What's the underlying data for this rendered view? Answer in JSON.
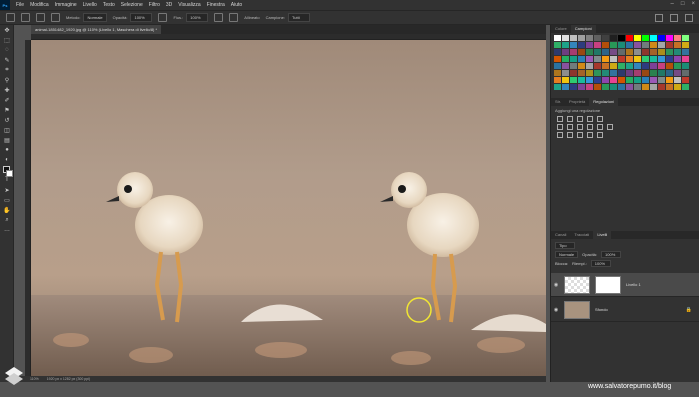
{
  "menubar": {
    "app_logo": "Ps",
    "items": [
      "File",
      "Modifica",
      "Immagine",
      "Livello",
      "Testo",
      "Selezione",
      "Filtro",
      "3D",
      "Visualizza",
      "Finestra",
      "Aiuto"
    ]
  },
  "options": {
    "metodo_label": "Metodo:",
    "metodo_value": "Normale",
    "opacita_label": "Opacità:",
    "opacita_value": "100%",
    "flusso_label": "Flus.:",
    "flusso_value": "100%",
    "allinea_label": "Allineato",
    "campione_label": "Campione:",
    "campione_value": "Tutti"
  },
  "document": {
    "tab_title": "animal-1851482_1920.jpg @ 110% (Livello 1, Maschera di livello/8) *",
    "zoom": "110%",
    "doc_info": "1920 px x 1282 px (300 ppi)"
  },
  "panels": {
    "top_tabs": [
      "Colore",
      "Campioni"
    ],
    "mid_tabs": [
      "Str.",
      "Proprietà",
      "Regolazioni"
    ],
    "adj_title": "Aggiungi una regolazione",
    "layer_tabs": [
      "Canali",
      "Tracciati",
      "Livelli"
    ],
    "layer_filter": "Tipo",
    "blend_mode": "Normale",
    "opacity_label": "Opacità:",
    "opacity_value": "100%",
    "lock_label": "Blocca:",
    "fill_label": "Riempi.:",
    "fill_value": "100%",
    "layers": [
      {
        "name": "Livello 1"
      },
      {
        "name": "Sfondo"
      }
    ]
  },
  "swatch_colors": [
    "#ffffff",
    "#e0e0e0",
    "#c0c0c0",
    "#a0a0a0",
    "#808080",
    "#606060",
    "#404040",
    "#202020",
    "#000000",
    "#ff0000",
    "#ffff00",
    "#00ff00",
    "#00ffff",
    "#0000ff",
    "#ff00ff",
    "#ff8080",
    "#80ff80"
  ],
  "footer": {
    "watermark": "www.salvatorepumo.it/blog"
  }
}
